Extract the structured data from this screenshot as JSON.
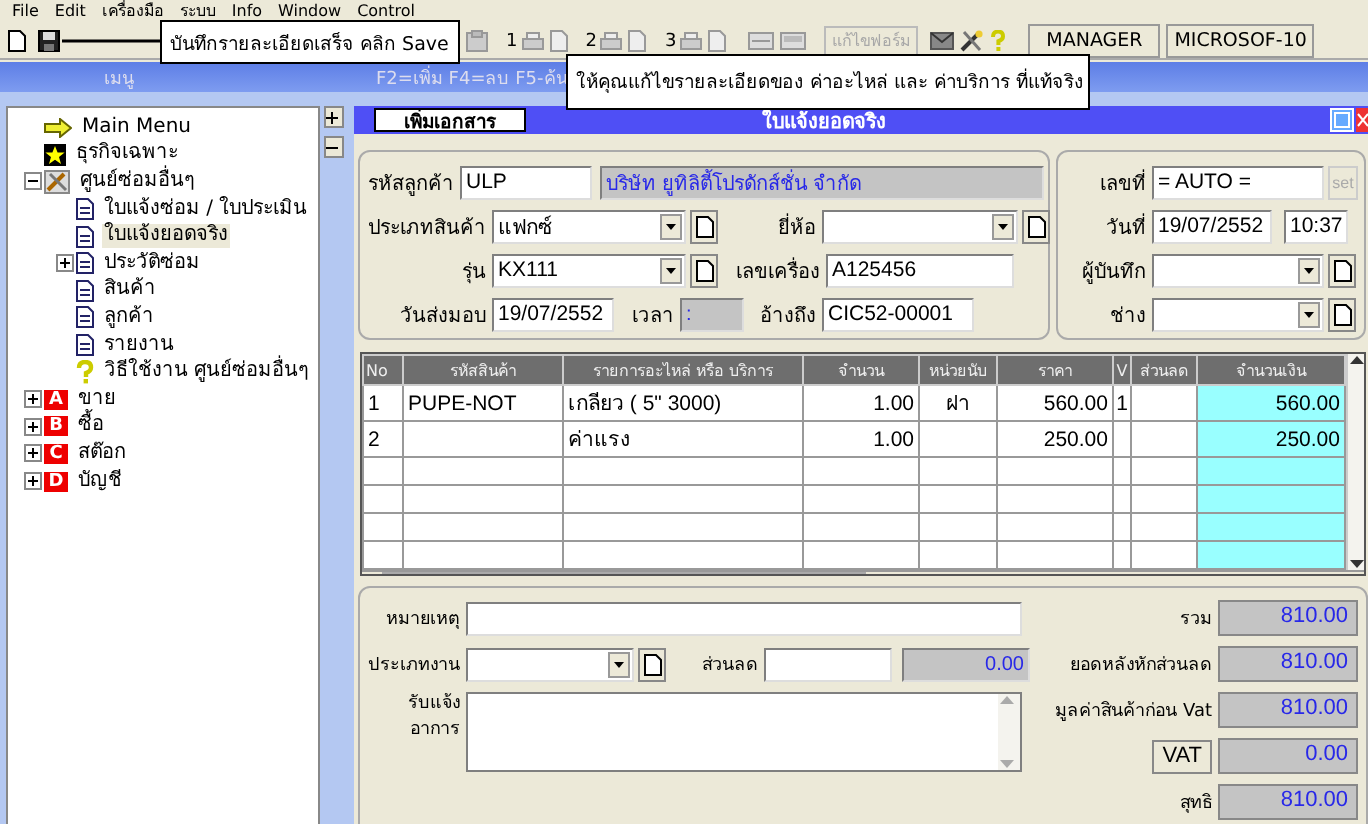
{
  "menu_bar": [
    "File",
    "Edit",
    "เครื่องมือ",
    "ระบบ",
    "Info",
    "Window",
    "Control"
  ],
  "toolbar": {
    "print_groups": [
      "1",
      "2",
      "3"
    ],
    "edit_form": {
      "label": "แก้ไขฟอร์ม",
      "disabled": true
    },
    "user": "MANAGER",
    "computer": "MICROSOF-10"
  },
  "callouts": [
    {
      "text": "บันทึกรายละเอียดเสร็จ คลิก Save"
    },
    {
      "text": "ให้คุณแก้ไขรายละเอียดของ ค่าอะไหล่ และ ค่าบริการ ที่แท้จริง"
    }
  ],
  "menu_panel": {
    "title": "เมนู",
    "tree": [
      {
        "label": "Main Menu",
        "kind": "arrow",
        "selected": false
      },
      {
        "label": "ธุรกิจเฉพาะ",
        "kind": "star",
        "selected": false
      },
      {
        "label": "ศูนย์ซ่อมอื่นๆ",
        "kind": "tools",
        "selected": false,
        "expanded": true,
        "children": [
          {
            "label": "ใบแจ้งซ่อม / ใบประเมิน",
            "kind": "doc",
            "selected": false
          },
          {
            "label": "ใบแจ้งยอดจริง",
            "kind": "doc",
            "selected": true
          },
          {
            "label": "ประวัติซ่อม",
            "kind": "doc",
            "selected": false,
            "expanded": false
          },
          {
            "label": "สินค้า",
            "kind": "doc",
            "selected": false
          },
          {
            "label": "ลูกค้า",
            "kind": "doc",
            "selected": false
          },
          {
            "label": "รายงาน",
            "kind": "doc",
            "selected": false
          },
          {
            "label": "วิธีใช้งาน ศูนย์ซ่อมอื่นๆ",
            "kind": "help",
            "selected": false
          }
        ]
      },
      {
        "label": "ขาย",
        "kind": "letter",
        "badge": "A",
        "selected": false,
        "expanded": false
      },
      {
        "label": "ซื้อ",
        "kind": "letter",
        "badge": "B",
        "selected": false,
        "expanded": false
      },
      {
        "label": "สต๊อก",
        "kind": "letter",
        "badge": "C",
        "selected": false,
        "expanded": false
      },
      {
        "label": "บัญชี",
        "kind": "letter",
        "badge": "D",
        "selected": false,
        "expanded": false
      }
    ]
  },
  "hotkeys": "F2=เพิ่ม F4=ลบ F5-ค้น",
  "form": {
    "add_button": "เพิ่มเอกสาร",
    "title": "ใบแจ้งยอดจริง",
    "customer": {
      "label": "รหัสลูกค้า",
      "code": "ULP",
      "name": "บริษัท ยูทิลิตี้โปรดักส์ชั่น จำกัด"
    },
    "product_type": {
      "label": "ประเภทสินค้า",
      "value": "แฟกซ์"
    },
    "brand": {
      "label": "ยี่ห้อ"
    },
    "model": {
      "label": "รุ่น",
      "value": "KX111"
    },
    "serial": {
      "label": "เลขเครื่อง",
      "value": "A125456"
    },
    "delivery_date": {
      "label": "วันส่งมอบ",
      "value": "19/07/2552"
    },
    "delivery_time": {
      "label": "เวลา",
      "value": ":"
    },
    "reference": {
      "label": "อ้างถึง",
      "value": "CIC52-00001"
    },
    "doc_no": {
      "label": "เลขที่",
      "value": "= AUTO =",
      "set_button": {
        "label": "set",
        "disabled": true
      }
    },
    "date": {
      "label": "วันที่",
      "value": "19/07/2552",
      "time": "10:37"
    },
    "recorder": {
      "label": "ผู้บันทึก"
    },
    "technician": {
      "label": "ช่าง"
    },
    "grid": {
      "columns": [
        "No",
        "รหัสสินค้า",
        "รายการอะไหล่ หรือ บริการ",
        "จำนวน",
        "หน่วยนับ",
        "ราคา",
        "V",
        "ส่วนลด",
        "จำนวนเงิน"
      ],
      "rows": [
        {
          "cells": [
            "1",
            "PUPE-NOT",
            "เกลียว ( 5\" 3000)",
            "1.00",
            "ฝา",
            "560.00",
            "1",
            null,
            "560.00"
          ]
        },
        {
          "cells": [
            "2",
            null,
            "ค่าแรง",
            "1.00",
            null,
            "250.00",
            null,
            null,
            "250.00"
          ]
        }
      ]
    },
    "remarks": {
      "label": "หมายเหตุ"
    },
    "job_type": {
      "label": "ประเภทงาน"
    },
    "discount": {
      "label": "ส่วนลด",
      "amount": "0.00"
    },
    "symptom": {
      "label": "รับแจ้ง อาการ"
    },
    "totals": [
      {
        "label": "รวม",
        "value": "810.00",
        "kind": "label"
      },
      {
        "label": "ยอดหลังหักส่วนลด",
        "value": "810.00",
        "kind": "label"
      },
      {
        "label": "มูลค่าสินค้าก่อน Vat",
        "value": "810.00",
        "kind": "label"
      },
      {
        "label": "VAT",
        "value": "0.00",
        "kind": "button"
      },
      {
        "label": "สุทธิ",
        "value": "810.00",
        "kind": "label"
      }
    ]
  }
}
